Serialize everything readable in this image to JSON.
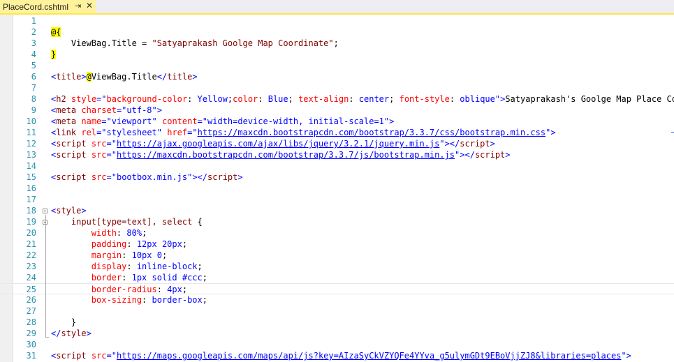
{
  "tab": {
    "title": "PlaceCord.cshtml",
    "pin_glyph": "⇥",
    "close_glyph": "✕"
  },
  "lines": [
    {
      "n": "1",
      "tokens": []
    },
    {
      "n": "2",
      "tokens": [
        {
          "c": "t-razor",
          "t": "@{"
        }
      ]
    },
    {
      "n": "3",
      "tokens": [
        {
          "c": "t-txt",
          "t": "    ViewBag.Title = "
        },
        {
          "c": "t-tag",
          "t": "\"Satyaprakash Goolge Map Coordinate\""
        },
        {
          "c": "t-txt",
          "t": ";"
        }
      ]
    },
    {
      "n": "4",
      "tokens": [
        {
          "c": "t-razor",
          "t": "}"
        }
      ]
    },
    {
      "n": "5",
      "tokens": []
    },
    {
      "n": "6",
      "tokens": [
        {
          "c": "t-punc",
          "t": "<"
        },
        {
          "c": "t-tag",
          "t": "title"
        },
        {
          "c": "t-punc",
          "t": ">"
        },
        {
          "c": "t-razor",
          "t": "@"
        },
        {
          "c": "t-txt",
          "t": "ViewBag.Title"
        },
        {
          "c": "t-punc",
          "t": "</"
        },
        {
          "c": "t-tag",
          "t": "title"
        },
        {
          "c": "t-punc",
          "t": ">"
        }
      ]
    },
    {
      "n": "7",
      "tokens": []
    },
    {
      "n": "8",
      "tokens": [
        {
          "c": "t-punc",
          "t": "<"
        },
        {
          "c": "t-tag",
          "t": "h2"
        },
        {
          "c": "t-txt",
          "t": " "
        },
        {
          "c": "t-attr",
          "t": "style"
        },
        {
          "c": "t-punc",
          "t": "=\""
        },
        {
          "c": "t-attr",
          "t": "background-color"
        },
        {
          "c": "t-txt",
          "t": ": "
        },
        {
          "c": "t-str",
          "t": "Yellow"
        },
        {
          "c": "t-txt",
          "t": ";"
        },
        {
          "c": "t-attr",
          "t": "color"
        },
        {
          "c": "t-txt",
          "t": ": "
        },
        {
          "c": "t-str",
          "t": "Blue"
        },
        {
          "c": "t-txt",
          "t": "; "
        },
        {
          "c": "t-attr",
          "t": "text-align"
        },
        {
          "c": "t-txt",
          "t": ": "
        },
        {
          "c": "t-str",
          "t": "center"
        },
        {
          "c": "t-txt",
          "t": "; "
        },
        {
          "c": "t-attr",
          "t": "font-style"
        },
        {
          "c": "t-txt",
          "t": ": "
        },
        {
          "c": "t-str",
          "t": "oblique"
        },
        {
          "c": "t-punc",
          "t": "\">"
        },
        {
          "c": "t-txt",
          "t": "Satyaprakash's Goolge Map Place Coord"
        }
      ]
    },
    {
      "n": "9",
      "tokens": [
        {
          "c": "t-punc",
          "t": "<"
        },
        {
          "c": "t-tag",
          "t": "meta"
        },
        {
          "c": "t-txt",
          "t": " "
        },
        {
          "c": "t-attr",
          "t": "charset"
        },
        {
          "c": "t-punc",
          "t": "=\""
        },
        {
          "c": "t-str",
          "t": "utf-8"
        },
        {
          "c": "t-punc",
          "t": "\">"
        }
      ]
    },
    {
      "n": "10",
      "tokens": [
        {
          "c": "t-punc",
          "t": "<"
        },
        {
          "c": "t-tag",
          "t": "meta"
        },
        {
          "c": "t-txt",
          "t": " "
        },
        {
          "c": "t-attr",
          "t": "name"
        },
        {
          "c": "t-punc",
          "t": "=\""
        },
        {
          "c": "t-str",
          "t": "viewport"
        },
        {
          "c": "t-punc",
          "t": "\""
        },
        {
          "c": "t-txt",
          "t": " "
        },
        {
          "c": "t-attr",
          "t": "content"
        },
        {
          "c": "t-punc",
          "t": "=\""
        },
        {
          "c": "t-str",
          "t": "width=device-width, initial-scale=1"
        },
        {
          "c": "t-punc",
          "t": "\">"
        }
      ]
    },
    {
      "n": "11",
      "tokens": [
        {
          "c": "t-punc",
          "t": "<"
        },
        {
          "c": "t-tag",
          "t": "link"
        },
        {
          "c": "t-txt",
          "t": " "
        },
        {
          "c": "t-attr",
          "t": "rel"
        },
        {
          "c": "t-punc",
          "t": "=\""
        },
        {
          "c": "t-str",
          "t": "stylesheet"
        },
        {
          "c": "t-punc",
          "t": "\""
        },
        {
          "c": "t-txt",
          "t": " "
        },
        {
          "c": "t-attr",
          "t": "href"
        },
        {
          "c": "t-punc",
          "t": "=\""
        },
        {
          "c": "t-url",
          "t": "https://maxcdn.bootstrapcdn.com/bootstrap/3.3.7/css/bootstrap.min.css"
        },
        {
          "c": "t-punc",
          "t": "\">"
        }
      ]
    },
    {
      "n": "12",
      "tokens": [
        {
          "c": "t-punc",
          "t": "<"
        },
        {
          "c": "t-tag",
          "t": "script"
        },
        {
          "c": "t-txt",
          "t": " "
        },
        {
          "c": "t-attr",
          "t": "src"
        },
        {
          "c": "t-punc",
          "t": "=\""
        },
        {
          "c": "t-url",
          "t": "https://ajax.googleapis.com/ajax/libs/jquery/3.2.1/jquery.min.js"
        },
        {
          "c": "t-punc",
          "t": "\"></"
        },
        {
          "c": "t-tag",
          "t": "script"
        },
        {
          "c": "t-punc",
          "t": ">"
        }
      ]
    },
    {
      "n": "13",
      "tokens": [
        {
          "c": "t-punc",
          "t": "<"
        },
        {
          "c": "t-tag",
          "t": "script"
        },
        {
          "c": "t-txt",
          "t": " "
        },
        {
          "c": "t-attr",
          "t": "src"
        },
        {
          "c": "t-punc",
          "t": "=\""
        },
        {
          "c": "t-url",
          "t": "https://maxcdn.bootstrapcdn.com/bootstrap/3.3.7/js/bootstrap.min.js"
        },
        {
          "c": "t-punc",
          "t": "\"></"
        },
        {
          "c": "t-tag",
          "t": "script"
        },
        {
          "c": "t-punc",
          "t": ">"
        }
      ]
    },
    {
      "n": "14",
      "tokens": []
    },
    {
      "n": "15",
      "tokens": [
        {
          "c": "t-punc",
          "t": "<"
        },
        {
          "c": "t-tag",
          "t": "script"
        },
        {
          "c": "t-txt",
          "t": " "
        },
        {
          "c": "t-attr",
          "t": "src"
        },
        {
          "c": "t-punc",
          "t": "=\""
        },
        {
          "c": "t-str",
          "t": "bootbox.min.js"
        },
        {
          "c": "t-punc",
          "t": "\"></"
        },
        {
          "c": "t-tag",
          "t": "script"
        },
        {
          "c": "t-punc",
          "t": ">"
        }
      ]
    },
    {
      "n": "16",
      "tokens": []
    },
    {
      "n": "17",
      "tokens": []
    },
    {
      "n": "18",
      "tokens": [
        {
          "c": "t-punc",
          "t": "<"
        },
        {
          "c": "t-tag",
          "t": "style"
        },
        {
          "c": "t-punc",
          "t": ">"
        }
      ]
    },
    {
      "n": "19",
      "tokens": [
        {
          "c": "t-txt",
          "t": "    "
        },
        {
          "c": "t-tag",
          "t": "input[type=text], select"
        },
        {
          "c": "t-txt",
          "t": " {"
        }
      ]
    },
    {
      "n": "20",
      "tokens": [
        {
          "c": "t-txt",
          "t": "        "
        },
        {
          "c": "t-css-prop",
          "t": "width"
        },
        {
          "c": "t-txt",
          "t": ": "
        },
        {
          "c": "t-css-val",
          "t": "80%"
        },
        {
          "c": "t-txt",
          "t": ";"
        }
      ]
    },
    {
      "n": "21",
      "tokens": [
        {
          "c": "t-txt",
          "t": "        "
        },
        {
          "c": "t-css-prop",
          "t": "padding"
        },
        {
          "c": "t-txt",
          "t": ": "
        },
        {
          "c": "t-css-val",
          "t": "12px 20px"
        },
        {
          "c": "t-txt",
          "t": ";"
        }
      ]
    },
    {
      "n": "22",
      "tokens": [
        {
          "c": "t-txt",
          "t": "        "
        },
        {
          "c": "t-css-prop",
          "t": "margin"
        },
        {
          "c": "t-txt",
          "t": ": "
        },
        {
          "c": "t-css-val",
          "t": "10px 0"
        },
        {
          "c": "t-txt",
          "t": ";"
        }
      ]
    },
    {
      "n": "23",
      "tokens": [
        {
          "c": "t-txt",
          "t": "        "
        },
        {
          "c": "t-css-prop",
          "t": "display"
        },
        {
          "c": "t-txt",
          "t": ": "
        },
        {
          "c": "t-css-val",
          "t": "inline-block"
        },
        {
          "c": "t-txt",
          "t": ";"
        }
      ]
    },
    {
      "n": "24",
      "tokens": [
        {
          "c": "t-txt",
          "t": "        "
        },
        {
          "c": "t-css-prop",
          "t": "border"
        },
        {
          "c": "t-txt",
          "t": ": "
        },
        {
          "c": "t-css-val",
          "t": "1px solid #ccc"
        },
        {
          "c": "t-txt",
          "t": ";"
        }
      ]
    },
    {
      "n": "25",
      "tokens": [
        {
          "c": "t-txt",
          "t": "        "
        },
        {
          "c": "t-css-prop",
          "t": "border-radius"
        },
        {
          "c": "t-txt",
          "t": ": "
        },
        {
          "c": "t-css-val",
          "t": "4px"
        },
        {
          "c": "t-txt",
          "t": ";"
        }
      ]
    },
    {
      "n": "26",
      "tokens": [
        {
          "c": "t-txt",
          "t": "        "
        },
        {
          "c": "t-css-prop",
          "t": "box-sizing"
        },
        {
          "c": "t-txt",
          "t": ": "
        },
        {
          "c": "t-css-val",
          "t": "border-box"
        },
        {
          "c": "t-txt",
          "t": ";"
        }
      ]
    },
    {
      "n": "27",
      "tokens": []
    },
    {
      "n": "28",
      "tokens": [
        {
          "c": "t-txt",
          "t": "    }"
        }
      ]
    },
    {
      "n": "29",
      "tokens": [
        {
          "c": "t-punc",
          "t": "</"
        },
        {
          "c": "t-tag",
          "t": "style"
        },
        {
          "c": "t-punc",
          "t": ">"
        }
      ]
    },
    {
      "n": "30",
      "tokens": []
    },
    {
      "n": "31",
      "tokens": [
        {
          "c": "t-punc",
          "t": "<"
        },
        {
          "c": "t-tag",
          "t": "script"
        },
        {
          "c": "t-txt",
          "t": " "
        },
        {
          "c": "t-attr",
          "t": "src"
        },
        {
          "c": "t-punc",
          "t": "=\""
        },
        {
          "c": "t-url",
          "t": "https://maps.googleapis.com/maps/api/js?key=AIzaSyCkVZYQFe4YYva_g5ulymGDt9EBoVjjZJ8&libraries=places"
        },
        {
          "c": "t-punc",
          "t": "\">"
        }
      ]
    }
  ]
}
